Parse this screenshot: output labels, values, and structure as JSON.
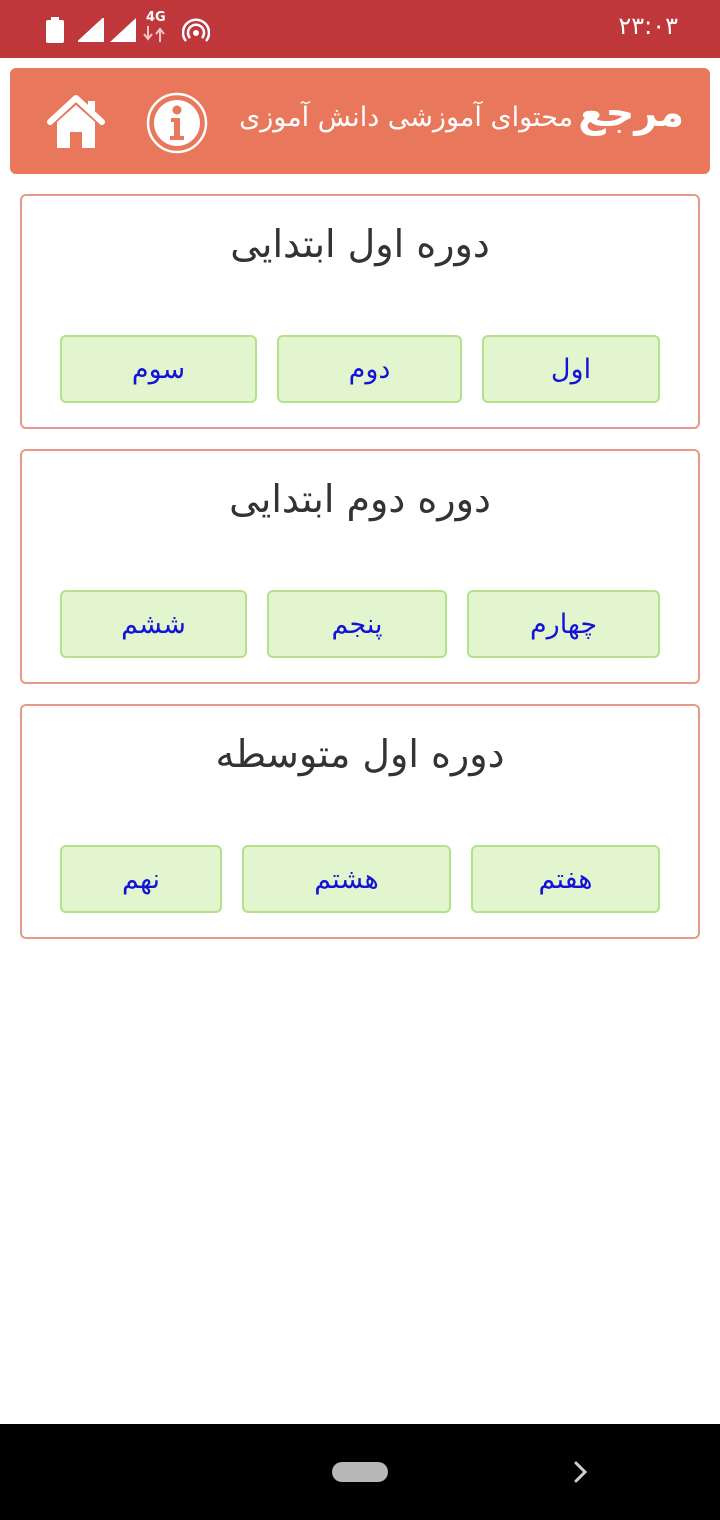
{
  "status_bar": {
    "time": "۲۳:۰۳",
    "network": "4G",
    "icons": [
      "battery-icon",
      "signal-icon",
      "signal-icon",
      "data-arrows-icon",
      "hotspot-icon"
    ]
  },
  "header": {
    "title_main": "مرجع",
    "title_sub": "محتوای آموزشی دانش آموزی",
    "icons": [
      "info-icon",
      "home-icon"
    ]
  },
  "sections": [
    {
      "title": "دوره اول ابتدایی",
      "buttons": [
        "اول",
        "دوم",
        "سوم"
      ]
    },
    {
      "title": "دوره دوم ابتدایی",
      "buttons": [
        "چهارم",
        "پنجم",
        "ششم"
      ]
    },
    {
      "title": "دوره اول متوسطه",
      "buttons": [
        "هفتم",
        "هشتم",
        "نهم"
      ]
    }
  ],
  "colors": {
    "status_bar": "#bf363b",
    "header": "#e8775b",
    "card_border": "#e8988a",
    "button_bg": "#e2f5cf",
    "button_border": "#b4e28a",
    "button_text": "#1313d8"
  }
}
